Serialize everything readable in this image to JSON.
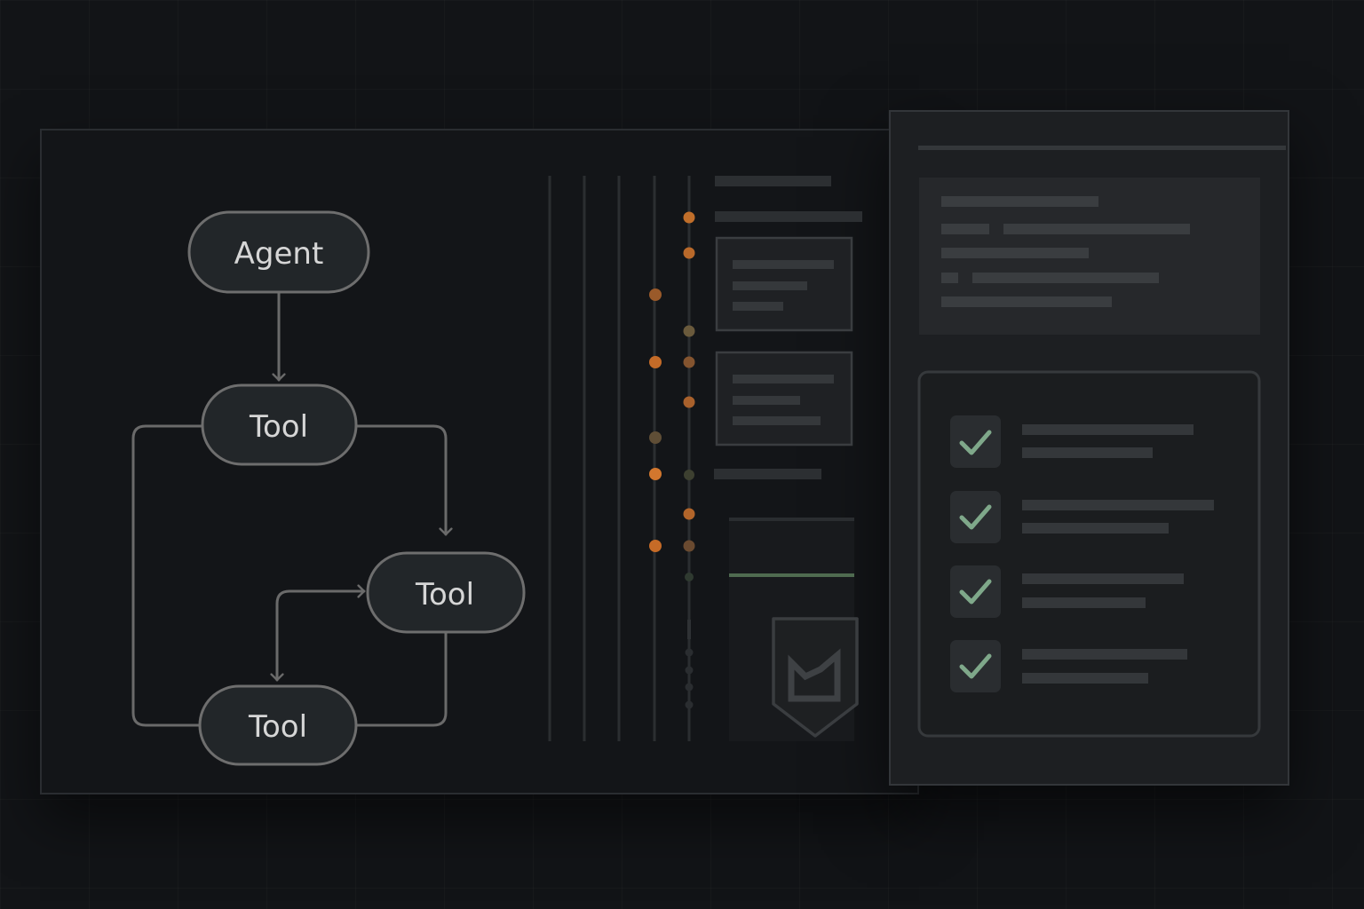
{
  "flow": {
    "nodes": [
      {
        "id": "agent",
        "label": "Agent"
      },
      {
        "id": "tool1",
        "label": "Tool"
      },
      {
        "id": "tool2",
        "label": "Tool"
      },
      {
        "id": "tool3",
        "label": "Tool"
      }
    ]
  },
  "colors": {
    "background": "#121417",
    "node_fill": "#222629",
    "node_stroke": "#6e6e6e",
    "edge": "#6a6a6a",
    "accent_orange": "#d77a2f",
    "accent_green": "#7fa88a",
    "placeholder_bar": "#2f3235"
  },
  "checklist": {
    "items": [
      {
        "checked": true
      },
      {
        "checked": true
      },
      {
        "checked": true
      },
      {
        "checked": true
      }
    ]
  }
}
